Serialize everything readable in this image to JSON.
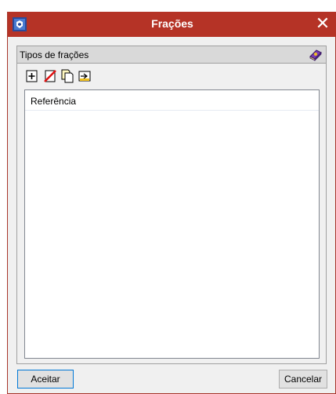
{
  "window": {
    "title": "Frações",
    "close_glyph": "✕",
    "accent_color": "#b53326"
  },
  "group": {
    "title": "Tipos de frações",
    "help_icon": "book-help-icon"
  },
  "toolbar": {
    "icons": [
      "add-icon",
      "delete-icon",
      "copy-icon",
      "import-icon"
    ]
  },
  "list": {
    "columns": [
      "Referência"
    ],
    "rows": []
  },
  "buttons": {
    "ok_label": "Aceitar",
    "cancel_label": "Cancelar"
  }
}
